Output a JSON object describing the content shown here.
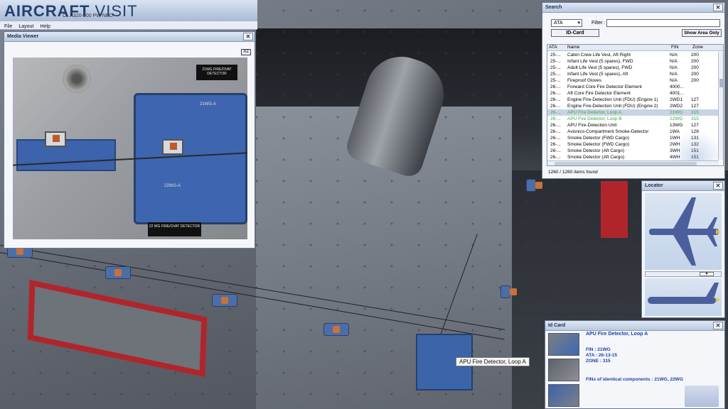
{
  "app": {
    "logo_bold": "AIRCRAFT",
    "logo_light": " VISIT",
    "aircraft": "CL A320-200 PW NEO"
  },
  "menu": [
    "File",
    "Layout",
    "Help"
  ],
  "viewport": {
    "tooltip": "APU Fire Detector, Loop A",
    "colors": {
      "frame": "#b0252c",
      "clip": "#4b6ea8"
    }
  },
  "media_viewer": {
    "title": "Media Viewer",
    "zoom_button": "X2",
    "photo_label_top": "21WG FIRE/OVAT DETECTOR",
    "photo_label_bottom": "22 WG FIRE/OVAT DETECTOR",
    "plate_text_1": "21WG-A",
    "plate_text_2": "22WG-A"
  },
  "search": {
    "title": "Search",
    "type_select": "ATA",
    "filter_label": "Filter :",
    "filter_value": "",
    "idcard_button": "ID-Card",
    "show_area_button": "Show Area Only",
    "columns": [
      "ATA",
      "Name",
      "FIN",
      "Zone"
    ],
    "rows": [
      [
        "25-...",
        "Cabin Crew Life Vest, Aft Right",
        "N/A",
        "200"
      ],
      [
        "25-...",
        "Infant Life Vest (5 spares), FWD",
        "N/A",
        "200"
      ],
      [
        "25-...",
        "Adult Life Vest (5 spares), FWD",
        "N/A",
        "200"
      ],
      [
        "25-...",
        "Infant Life Vest (5 spares), Aft",
        "N/A",
        "200"
      ],
      [
        "25-...",
        "Fireproof Gloves",
        "N/A",
        "200"
      ],
      [
        "26-...",
        "Forward Core Fire Detector Element",
        "4000...",
        ""
      ],
      [
        "26-...",
        "Aft Core Fire Detector Element",
        "4001...",
        ""
      ],
      [
        "26-...",
        "Engine Fire-Detection Unit (FDU) (Engine 1)",
        "2WD1",
        "127"
      ],
      [
        "26-...",
        "Engine Fire-Detection Unit (FDU) (Engine 2)",
        "2WD2",
        "127"
      ],
      [
        "26-...",
        "APU Fire Detector, Loop A",
        "21WG",
        "315"
      ],
      [
        "26-...",
        "APU Fire Detector, Loop B",
        "22WG",
        "315"
      ],
      [
        "26-...",
        "APU Fire-Detection Unit",
        "13WG",
        "127"
      ],
      [
        "26-...",
        "Avionics-Compartment Smoke-Detector",
        "1WA",
        "128"
      ],
      [
        "26-...",
        "Smoke Detector (FWD Cargo)",
        "1WH",
        "131"
      ],
      [
        "26-...",
        "Smoke Detector (FWD Cargo)",
        "2WH",
        "132"
      ],
      [
        "26-...",
        "Smoke Detector (Aft Cargo)",
        "3WH",
        "151"
      ],
      [
        "26-...",
        "Smoke Detector (Aft Cargo)",
        "4WH",
        "151"
      ]
    ],
    "selected_row": 9,
    "status": "1260 / 1260 items found"
  },
  "locator": {
    "title": "Locator",
    "aircraft_color": "#4a5f9c",
    "marker_color": "#f0c020"
  },
  "idcard": {
    "title": "Id Card",
    "name": "APU Fire Detector, Loop A",
    "fin": "FIN : 21WG",
    "ata": "ATA : 26-13-15",
    "zone": "ZONE : 315",
    "identical": "FINs of identical components : 21WG, 22WG"
  }
}
